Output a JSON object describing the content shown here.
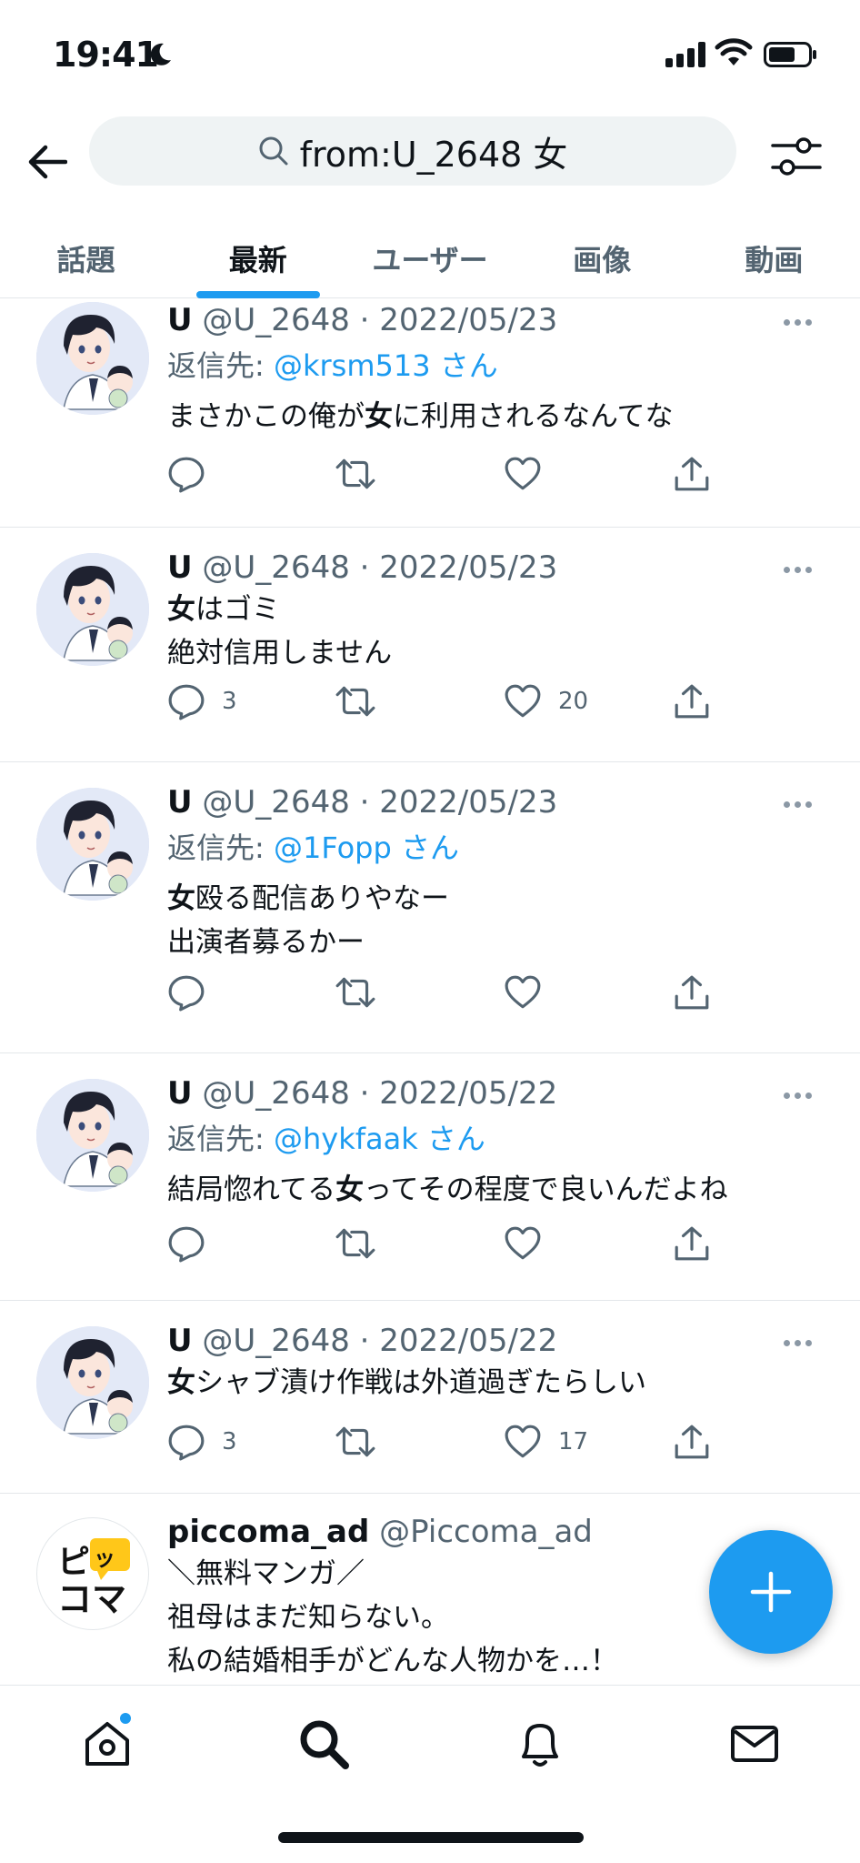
{
  "status_bar": {
    "time": "19:41"
  },
  "search": {
    "query": "from:U_2648 女"
  },
  "tabs": [
    {
      "label": "話題",
      "active": false
    },
    {
      "label": "最新",
      "active": true
    },
    {
      "label": "ユーザー",
      "active": false
    },
    {
      "label": "画像",
      "active": false
    },
    {
      "label": "動画",
      "active": false
    }
  ],
  "tweets": [
    {
      "name": "U",
      "handle": "@U_2648",
      "date": "2022/05/23",
      "reply_prefix": "返信先: ",
      "reply_mention": "@krsm513",
      "reply_suffix": " さん",
      "text_lines": [
        {
          "pre": "まさかこの俺が",
          "bold": "女",
          "post": "に利用されるなんてな"
        }
      ],
      "reply_count": "",
      "like_count": ""
    },
    {
      "name": "U",
      "handle": "@U_2648",
      "date": "2022/05/23",
      "text_lines": [
        {
          "pre": "",
          "bold": "女",
          "post": "はゴミ"
        },
        {
          "pre": "絶対信用しません",
          "bold": "",
          "post": ""
        }
      ],
      "reply_count": "3",
      "like_count": "20"
    },
    {
      "name": "U",
      "handle": "@U_2648",
      "date": "2022/05/23",
      "reply_prefix": "返信先: ",
      "reply_mention": "@1Fopp",
      "reply_suffix": " さん",
      "text_lines": [
        {
          "pre": "",
          "bold": "女",
          "post": "殴る配信ありやなー"
        },
        {
          "pre": "出演者募るかー",
          "bold": "",
          "post": ""
        }
      ],
      "reply_count": "",
      "like_count": ""
    },
    {
      "name": "U",
      "handle": "@U_2648",
      "date": "2022/05/22",
      "reply_prefix": "返信先: ",
      "reply_mention": "@hykfaak",
      "reply_suffix": " さん",
      "text_lines": [
        {
          "pre": "結局惚れてる",
          "bold": "女",
          "post": "ってその程度で良いんだよね"
        }
      ],
      "reply_count": "",
      "like_count": ""
    },
    {
      "name": "U",
      "handle": "@U_2648",
      "date": "2022/05/22",
      "text_lines": [
        {
          "pre": "",
          "bold": "女",
          "post": "シャブ漬け作戦は外道過ぎたらしい"
        }
      ],
      "reply_count": "3",
      "like_count": "17"
    }
  ],
  "ad": {
    "name": "piccoma_ad",
    "handle": "@Piccoma_ad",
    "logo_line1": "ピッ",
    "logo_line2": "コマ",
    "text_lines": [
      "＼無料マンガ／",
      "祖母はまだ知らない。",
      "私の結婚相手がどんな人物かを…！"
    ]
  },
  "colors": {
    "accent": "#1d9bf0",
    "text": "#0f1419",
    "secondary": "#536471",
    "divider": "#e3e7ea",
    "search_bg": "#eff3f4"
  },
  "icons": {
    "back": "arrow-left-icon",
    "search": "search-icon",
    "filter": "sliders-icon",
    "reply": "comment-icon",
    "retweet": "retweet-icon",
    "like": "heart-icon",
    "share": "share-icon",
    "more": "more-dots-icon",
    "compose": "plus-icon",
    "home": "home-icon",
    "explore": "search-icon",
    "notifications": "bell-icon",
    "messages": "envelope-icon"
  }
}
